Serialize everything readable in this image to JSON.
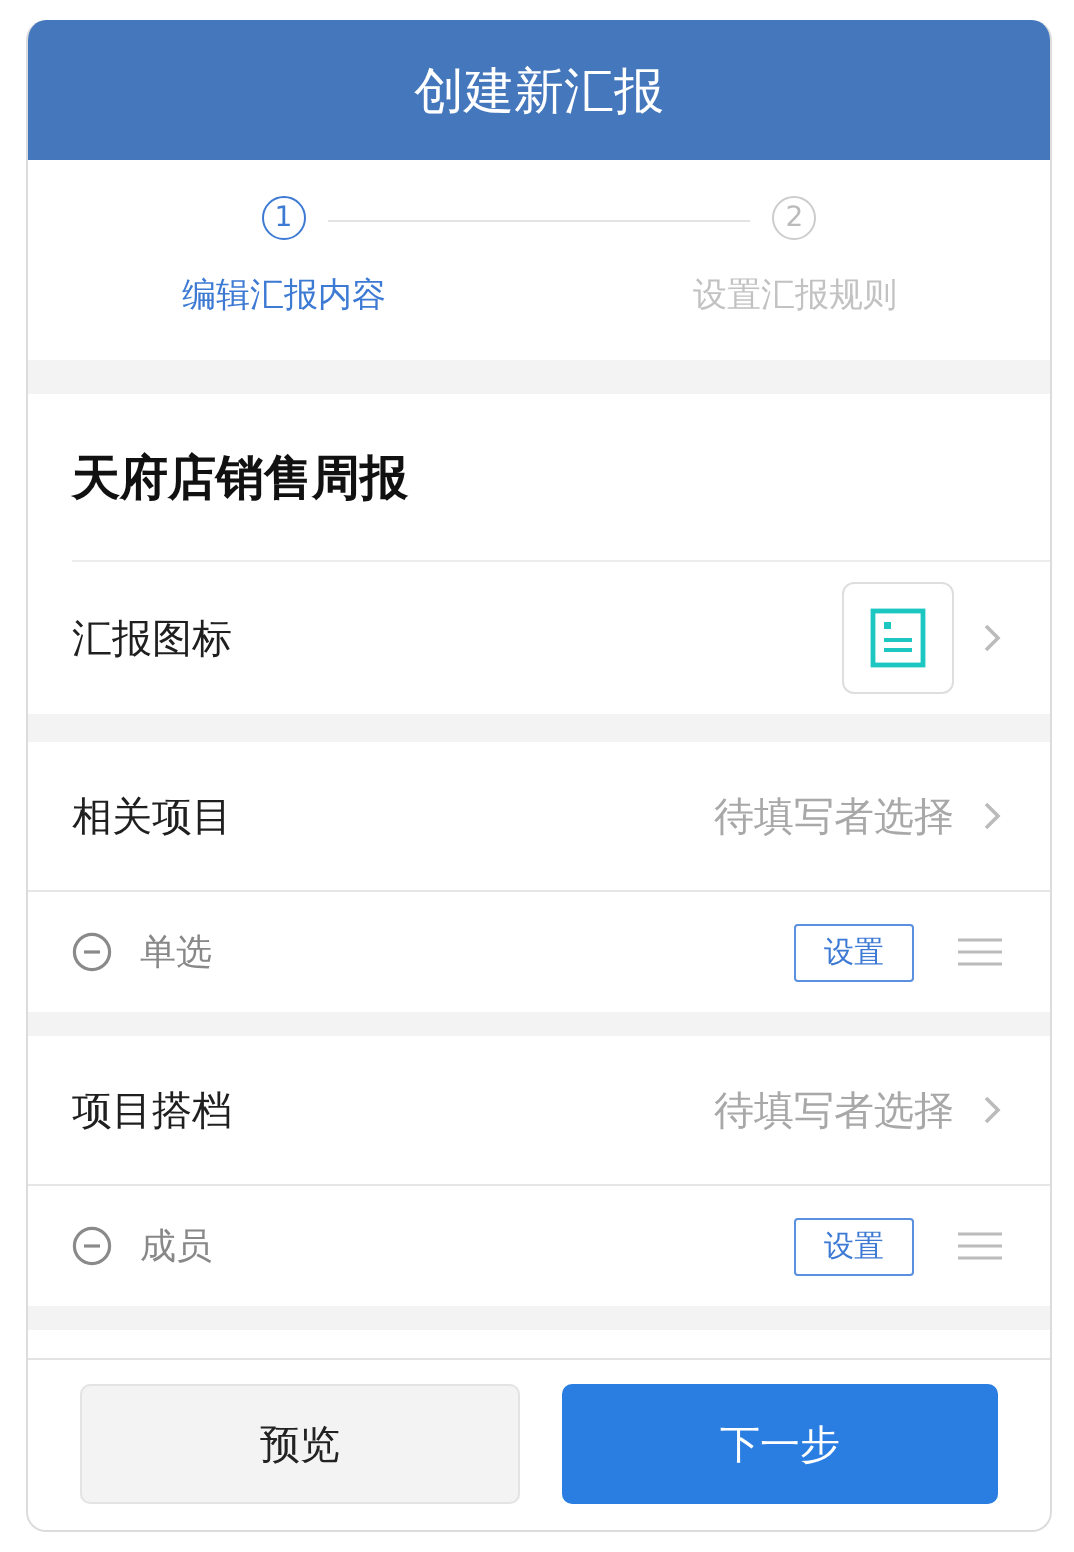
{
  "header": {
    "title": "创建新汇报"
  },
  "steps": [
    {
      "number": "1",
      "label": "编辑汇报内容",
      "selected": true
    },
    {
      "number": "2",
      "label": "设置汇报规则",
      "selected": false
    }
  ],
  "report_title": "天府店销售周报",
  "icon_row": {
    "label": "汇报图标"
  },
  "fields": [
    {
      "label": "相关项目",
      "placeholder": "待填写者选择",
      "option": "单选",
      "setting_button": "设置"
    },
    {
      "label": "项目搭档",
      "placeholder": "待填写者选择",
      "option": "成员",
      "setting_button": "设置"
    }
  ],
  "footer": {
    "buttons": [
      {
        "label": "预览",
        "kind": "secondary"
      },
      {
        "label": "下一步",
        "kind": "primary"
      }
    ]
  }
}
